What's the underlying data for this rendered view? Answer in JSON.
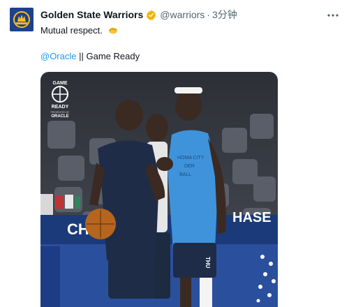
{
  "account": {
    "name": "Golden State Warriors",
    "handle": "@warriors",
    "separator": "·",
    "time": "3分钟"
  },
  "tweet": {
    "line1": "Mutual respect.",
    "mention": "@Oracle",
    "line2_rest": " || Game Ready"
  },
  "media": {
    "badge_top": "GAME",
    "badge_bottom": "READY",
    "badge_presented": "PRESENTED BY",
    "badge_brand": "ORACLE",
    "banner_left": "CHA",
    "banner_right": "HASE",
    "shirt_line1": "HOMA CITY",
    "shirt_line2": "DER",
    "shirt_line3": "BALL",
    "shorts_text": "THU"
  },
  "icons": {
    "verified": "verified-badge-icon",
    "handshake": "handshake-emoji-icon",
    "more": "more-icon",
    "avatar": "warriors-logo-icon"
  },
  "colors": {
    "verified": "#f2b300",
    "link": "#1d9bf0",
    "brand": "#1d428a"
  }
}
